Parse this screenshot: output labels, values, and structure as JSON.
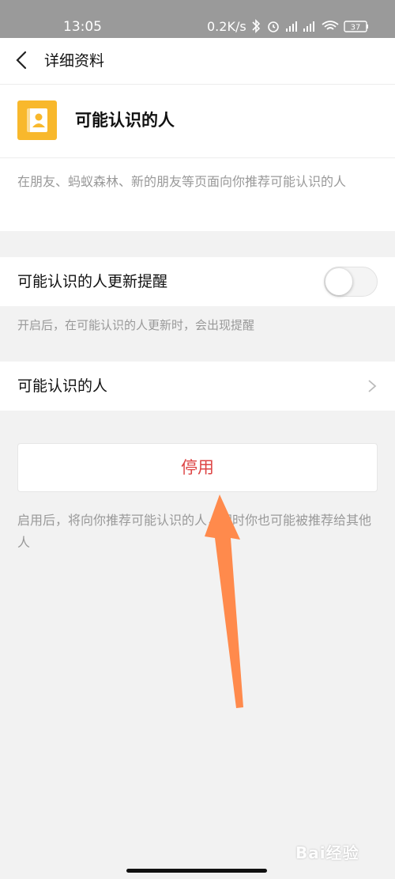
{
  "status": {
    "time": "13:05",
    "net_speed": "0.2K/s",
    "battery": "37",
    "icons": [
      "bluetooth-icon",
      "alarm-icon",
      "signal-hd-icon",
      "signal-hd-icon",
      "wifi-icon",
      "battery-icon"
    ]
  },
  "nav": {
    "title": "详细资料",
    "back_icon": "chevron-left-icon"
  },
  "info": {
    "app_name": "可能认识的人",
    "icon": "contact-book-icon",
    "icon_color": "#f8b82c",
    "description": "在朋友、蚂蚁森林、新的朋友等页面向你推荐可能认识的人"
  },
  "settings": {
    "remind_label": "可能认识的人更新提醒",
    "remind_enabled": false,
    "remind_hint": "开启后，在可能认识的人更新时，会出现提醒",
    "people_label": "可能认识的人"
  },
  "action": {
    "disable_label": "停用",
    "disable_color": "#d44444",
    "hint": "启用后，将向你推荐可能认识的人，同时你也可能被推荐给其他人"
  },
  "overlay": {
    "arrow_color": "#ff8a4c"
  },
  "watermark": {
    "text": "Bai经验"
  }
}
